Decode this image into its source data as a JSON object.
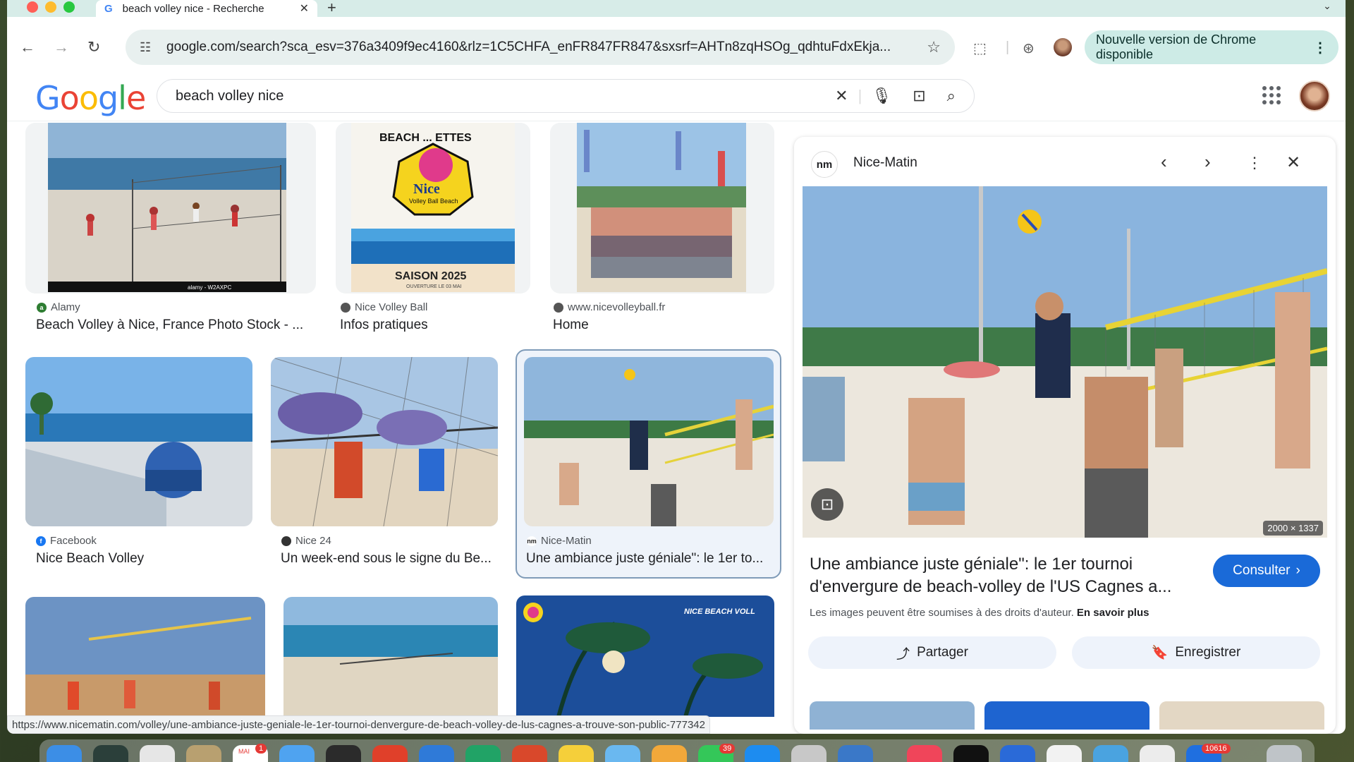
{
  "browser": {
    "tab_title": "beach volley nice - Recherche",
    "url": "google.com/search?sca_esv=376a3409f9ec4160&rlz=1C5CHFA_enFR847FR847&sxsrf=AHTn8zqHSOg_qdhtuFdxEkja...",
    "update_label": "Nouvelle version de Chrome disponible",
    "status_url": "https://www.nicematin.com/volley/une-ambiance-juste-geniale-le-1er-tournoi-denvergure-de-beach-volley-de-lus-cagnes-a-trouve-son-public-777342"
  },
  "search": {
    "query": "beach volley nice"
  },
  "results": [
    {
      "source": "Alamy",
      "caption": "Beach Volley à Nice, France Photo Stock - ..."
    },
    {
      "source": "Nice Volley Ball",
      "caption": "Infos pratiques"
    },
    {
      "source": "www.nicevolleyball.fr",
      "caption": "Home"
    },
    {
      "source": "Facebook",
      "caption": "Nice Beach Volley"
    },
    {
      "source": "Nice 24",
      "caption": "Un week-end sous le signe du Be..."
    },
    {
      "source": "Nice-Matin",
      "caption": "Une ambiance juste géniale\": le 1er to..."
    }
  ],
  "thumb_text": {
    "saison": "SAISON 2025",
    "ouverture": "OUVERTURE LE 03 MAI",
    "poster_top": "BEACH ... ETTES",
    "nice_logo": "Nice",
    "nice_sub": "Volley Ball Beach",
    "alamy_wm": "alamy - W2AXPC",
    "nbv": "NICE BEACH VOLL"
  },
  "panel": {
    "site_logo": "nm",
    "site": "Nice-Matin",
    "dims": "2000 × 1337",
    "title": "Une ambiance juste géniale\": le 1er tournoi d'envergure de beach-volley de l'US Cagnes a...",
    "consult_label": "Consulter",
    "copyright_text": "Les images peuvent être soumises à des droits d'auteur.",
    "learn_more": "En savoir plus",
    "share_label": "Partager",
    "save_label": "Enregistrer"
  },
  "dock": {
    "badge_cal": "MAI",
    "badge_cal_count": "1",
    "badge_msg": "39",
    "badge_mail": "10616"
  }
}
